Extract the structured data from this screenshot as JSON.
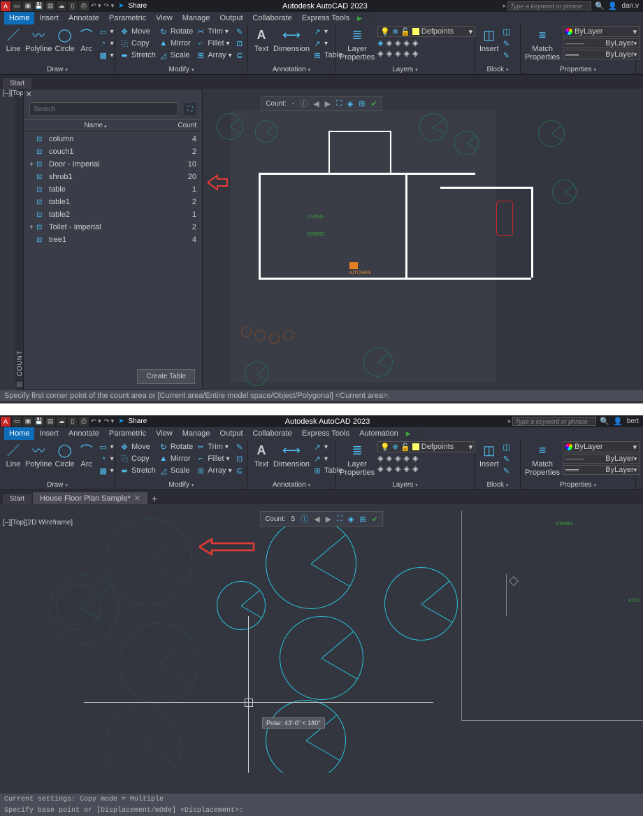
{
  "title": "Autodesk AutoCAD 2023",
  "search_placeholder": "Type a keyword or phrase",
  "share": "Share",
  "user1": "dan.v",
  "user2": "bert",
  "menu": [
    "Home",
    "Insert",
    "Annotate",
    "Parametric",
    "View",
    "Manage",
    "Output",
    "Collaborate",
    "Express Tools",
    "Automation"
  ],
  "ribbon": {
    "draw": "Draw",
    "modify": "Modify",
    "annotation": "Annotation",
    "layers": "Layers",
    "block": "Block",
    "properties": "Properties",
    "line": "Line",
    "polyline": "Polyline",
    "circle": "Circle",
    "arc": "Arc",
    "move": "Move",
    "rotate": "Rotate",
    "trim": "Trim",
    "copy": "Copy",
    "mirror": "Mirror",
    "fillet": "Fillet",
    "stretch": "Stretch",
    "scale": "Scale",
    "array": "Array",
    "text": "Text",
    "dimension": "Dimension",
    "table": "Table",
    "layerprops": "Layer\nProperties",
    "layer_name": "Defpoints",
    "insert": "Insert",
    "match": "Match\nProperties",
    "bylayer": "ByLayer"
  },
  "tabs": {
    "start": "Start",
    "file": "House Floor Plan Sample*"
  },
  "viewlabel": "[–][Top][2D Wireframe]",
  "count_palette": {
    "search": "Search",
    "name": "Name",
    "count": "Count",
    "create": "Create Table",
    "side": "COUNT",
    "rows": [
      {
        "name": "column",
        "count": "4",
        "exp": ""
      },
      {
        "name": "couch1",
        "count": "2",
        "exp": ""
      },
      {
        "name": "Door - Imperial",
        "count": "10",
        "exp": "+"
      },
      {
        "name": "shrub1",
        "count": "20",
        "exp": ""
      },
      {
        "name": "table",
        "count": "1",
        "exp": ""
      },
      {
        "name": "table1",
        "count": "2",
        "exp": ""
      },
      {
        "name": "table2",
        "count": "1",
        "exp": ""
      },
      {
        "name": "Toilet - Imperial",
        "count": "2",
        "exp": "+"
      },
      {
        "name": "tree1",
        "count": "4",
        "exp": ""
      }
    ]
  },
  "count_tb": {
    "label": "Count:",
    "val1": "-",
    "val2": "5"
  },
  "rooms": {
    "living": "LIVING",
    "dining": "DINING",
    "kitchen": "KITCHEN",
    "dining2": "DINING",
    "kitc": "KITC"
  },
  "tooltip": "Polar: 43'-0\" < 180°",
  "cmd1": "Specify first corner point of the count area or [Current area/Entire model space/Object/Polygonal] <Current area>:",
  "cmd2a": "Current settings:  Copy mode = Multiple",
  "cmd2b": "Specify base point or [Displacement/mOde] <Displacement>:"
}
